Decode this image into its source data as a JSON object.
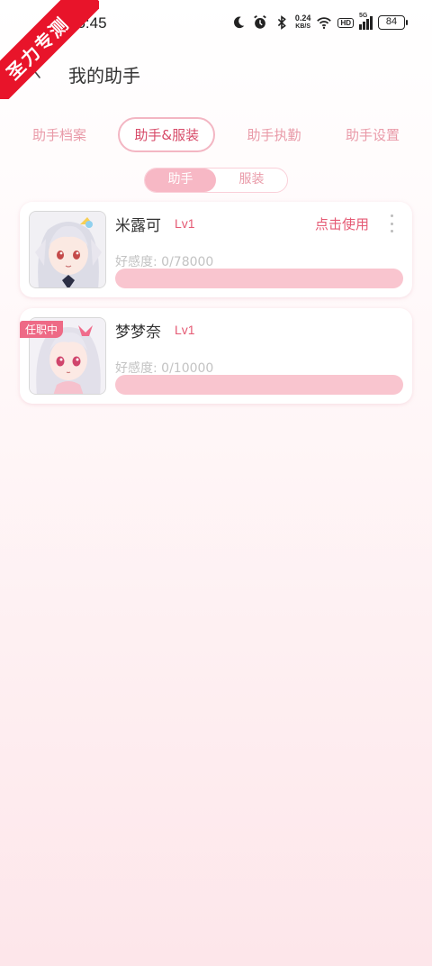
{
  "status_bar": {
    "time": "15:45",
    "net_speed_value": "0.24",
    "net_speed_unit": "KB/S",
    "hd_label": "HD",
    "signal_label": "5G",
    "battery": "84",
    "icons": [
      "moon-icon",
      "alarm-icon",
      "bluetooth-icon",
      "wifi-icon",
      "signal-icon",
      "battery-icon"
    ]
  },
  "watermark": {
    "text": "圣力专测",
    "color": "#e8142a"
  },
  "header": {
    "title": "我的助手"
  },
  "tabs": [
    {
      "label": "助手档案",
      "active": false
    },
    {
      "label": "助手&服装",
      "active": true
    },
    {
      "label": "助手执勤",
      "active": false
    },
    {
      "label": "助手设置",
      "active": false
    }
  ],
  "segment": [
    {
      "label": "助手",
      "active": true
    },
    {
      "label": "服装",
      "active": false
    }
  ],
  "assistants": [
    {
      "name": "米露可",
      "level": "Lv1",
      "action": "点击使用",
      "affinity_label": "好感度: 0/78000",
      "affinity_progress": 0
    },
    {
      "name": "梦梦奈",
      "level": "Lv1",
      "badge": "任职中",
      "affinity_label": "好感度: 0/10000",
      "affinity_progress": 0
    }
  ],
  "colors": {
    "accent": "#e55a74",
    "tab_inactive": "#e99aa8",
    "bar": "#f9c5cf"
  }
}
